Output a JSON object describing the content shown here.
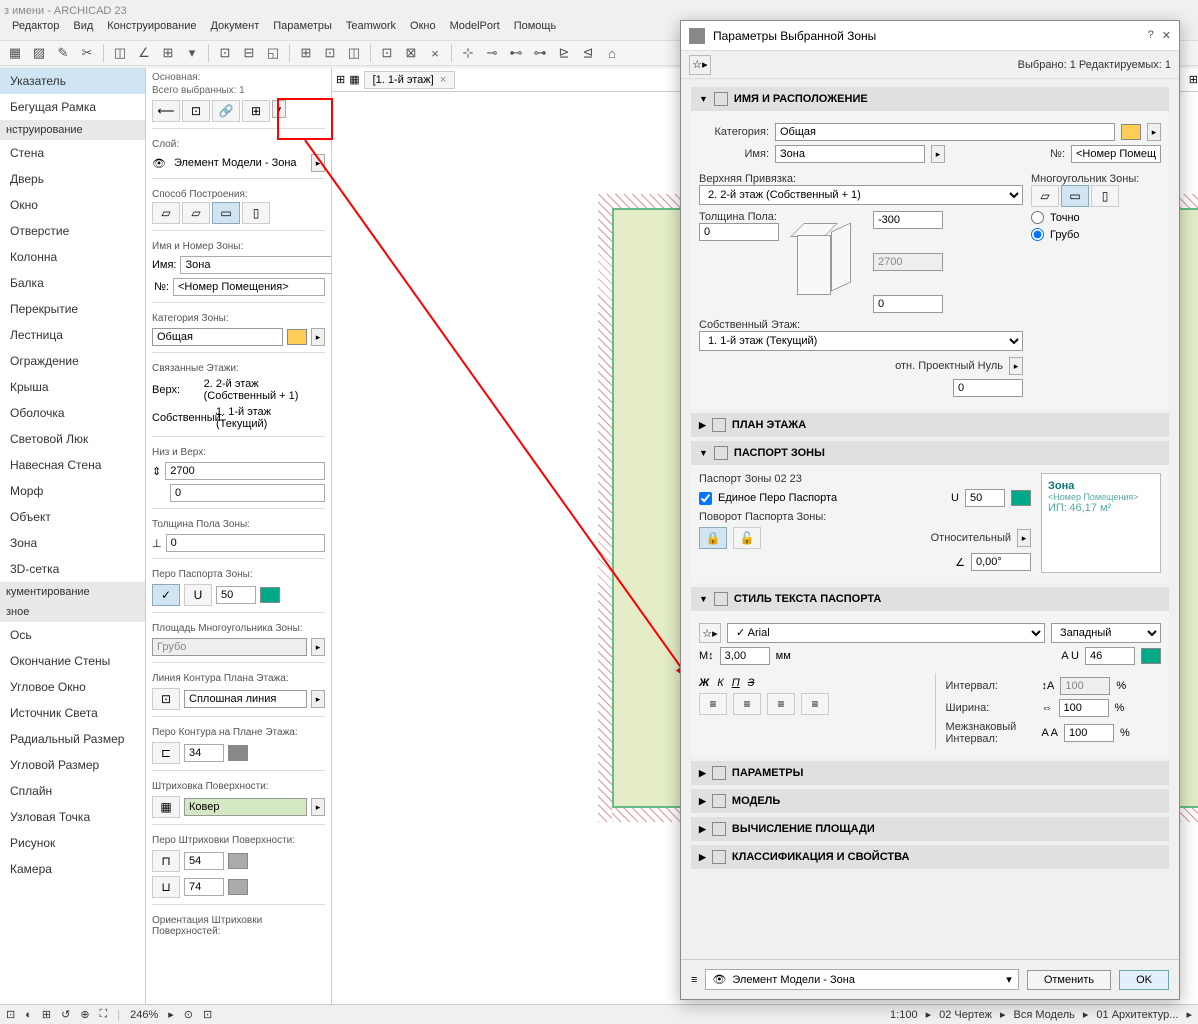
{
  "title": "з имени - ARCHICAD 23",
  "menu": [
    "Редактор",
    "Вид",
    "Конструирование",
    "Документ",
    "Параметры",
    "Teamwork",
    "Окно",
    "ModelPort",
    "Помощь"
  ],
  "leftpanel": {
    "design_hdr": "нструирование",
    "doc_hdr": "кументирование",
    "misc_hdr": "зное",
    "items_top": [
      "Указатель",
      "Бегущая Рамка"
    ],
    "items_design": [
      "Стена",
      "Дверь",
      "Окно",
      "Отверстие",
      "Колонна",
      "Балка",
      "Перекрытие",
      "Лестница",
      "Ограждение",
      "Крыша",
      "Оболочка",
      "Световой Люк",
      "Навесная Стена",
      "Морф",
      "Объект",
      "Зона",
      "3D-сетка"
    ],
    "items_doc_misc": [
      "Ось",
      "Окончание Стены",
      "Угловое Окно",
      "Источник Света",
      "Радиальный Размер",
      "Угловой Размер",
      "Сплайн",
      "Узловая Точка",
      "Рисунок",
      "Камера"
    ]
  },
  "infobox": {
    "main_label": "Основная:",
    "selected_label": "Всего выбранных: 1",
    "layer_label": "Слой:",
    "layer_value": "Элемент Модели - Зона",
    "method_label": "Способ Построения:",
    "namegroup_label": "Имя и Номер Зоны:",
    "name_label": "Имя:",
    "name_value": "Зона",
    "number_label": "№:",
    "number_value": "<Номер Помещения>",
    "category_label": "Категория Зоны:",
    "category_value": "Общая",
    "linked_label": "Связанные Этажи:",
    "linked_top_l": "Верх:",
    "linked_top": "2. 2-й этаж (Собственный + 1)",
    "linked_own_l": "Собственный:",
    "linked_own": "1. 1-й этаж (Текущий)",
    "heights_label": "Низ и Верх:",
    "height_top": "2700",
    "height_bottom": "0",
    "floorthick_label": "Толщина Пола Зоны:",
    "floorthick_value": "0",
    "stamp_pen_label": "Перо Паспорта Зоны:",
    "stamp_pen": "50",
    "polyarea_label": "Площадь Многоугольника Зоны:",
    "polyarea_value": "Грубо",
    "outline_label": "Линия Контура Плана Этажа:",
    "outline_value": "Сплошная линия",
    "outline_pen_label": "Перо Контура на Плане Этажа:",
    "outline_pen": "34",
    "fill_label": "Штриховка Поверхности:",
    "fill_value": "Ковер",
    "fill_pen_label": "Перо Штриховки Поверхности:",
    "fill_pen1": "54",
    "fill_pen2": "74",
    "fill_orient_label": "Ориентация Штриховки Поверхностей:"
  },
  "tab": "[1. 1-й этаж]",
  "dialog": {
    "title": "Параметры Выбранной Зоны",
    "help": "?",
    "close": "✕",
    "selcount": "Выбрано: 1 Редактируемых: 1",
    "sec_name": "ИМЯ И РАСПОЛОЖЕНИЕ",
    "category_l": "Категория:",
    "category_v": "Общая",
    "name_l": "Имя:",
    "name_v": "Зона",
    "num_l": "№:",
    "num_v": "<Номер Помещ",
    "toplink_l": "Верхняя Привязка:",
    "toplink_v": "2. 2-й этаж (Собственный + 1)",
    "poly_l": "Многоугольник Зоны:",
    "poly_exact": "Точно",
    "poly_rough": "Грубо",
    "floorthick_l": "Толщина Пола:",
    "floorthick_v": "0",
    "val_top": "-300",
    "val_mid": "2700",
    "val_bot": "0",
    "homestory_l": "Собственный Этаж:",
    "homestory_v": "1. 1-й этаж (Текущий)",
    "projzero_l": "отн. Проектный Нуль",
    "projzero_v": "0",
    "sec_floor": "ПЛАН ЭТАЖА",
    "sec_stamp": "ПАСПОРТ ЗОНЫ",
    "stamp_name": "Паспорт Зоны 02 23",
    "stamp_single": "Единое Перо Паспорта",
    "stamp_pen": "50",
    "stamp_rot_l": "Поворот Паспорта Зоны:",
    "stamp_relative": "Относительный",
    "stamp_angle": "0,00°",
    "preview_title": "Зона",
    "preview_sub": "<Номер Помещения>",
    "preview_ip": "ИП:",
    "preview_area": "46,17 м²",
    "sec_textstyle": "СТИЛЬ ТЕКСТА ПАСПОРТА",
    "font": "Arial",
    "script": "Западный",
    "size": "3,00",
    "size_unit": "мм",
    "pen2": "46",
    "spacing_l": "Интервал:",
    "spacing_v": "100",
    "width_l": "Ширина:",
    "width_v": "100",
    "kerning_l": "Межзнаковый Интервал:",
    "kerning_v": "100",
    "percent": "%",
    "bold": "Ж",
    "italic": "К",
    "underline": "П",
    "strike": "З",
    "sec_params": "ПАРАМЕТРЫ",
    "sec_model": "МОДЕЛЬ",
    "sec_area": "ВЫЧИСЛЕНИЕ ПЛОЩАДИ",
    "sec_class": "КЛАССИФИКАЦИЯ И СВОЙСТВА",
    "layer": "Элемент Модели - Зона",
    "cancel": "Отменить",
    "ok": "OK"
  },
  "status": {
    "zoom": "246%",
    "scale": "1:100",
    "view": "02 Чертеж",
    "model": "Вся Модель",
    "arch": "01 Архитектур..."
  }
}
